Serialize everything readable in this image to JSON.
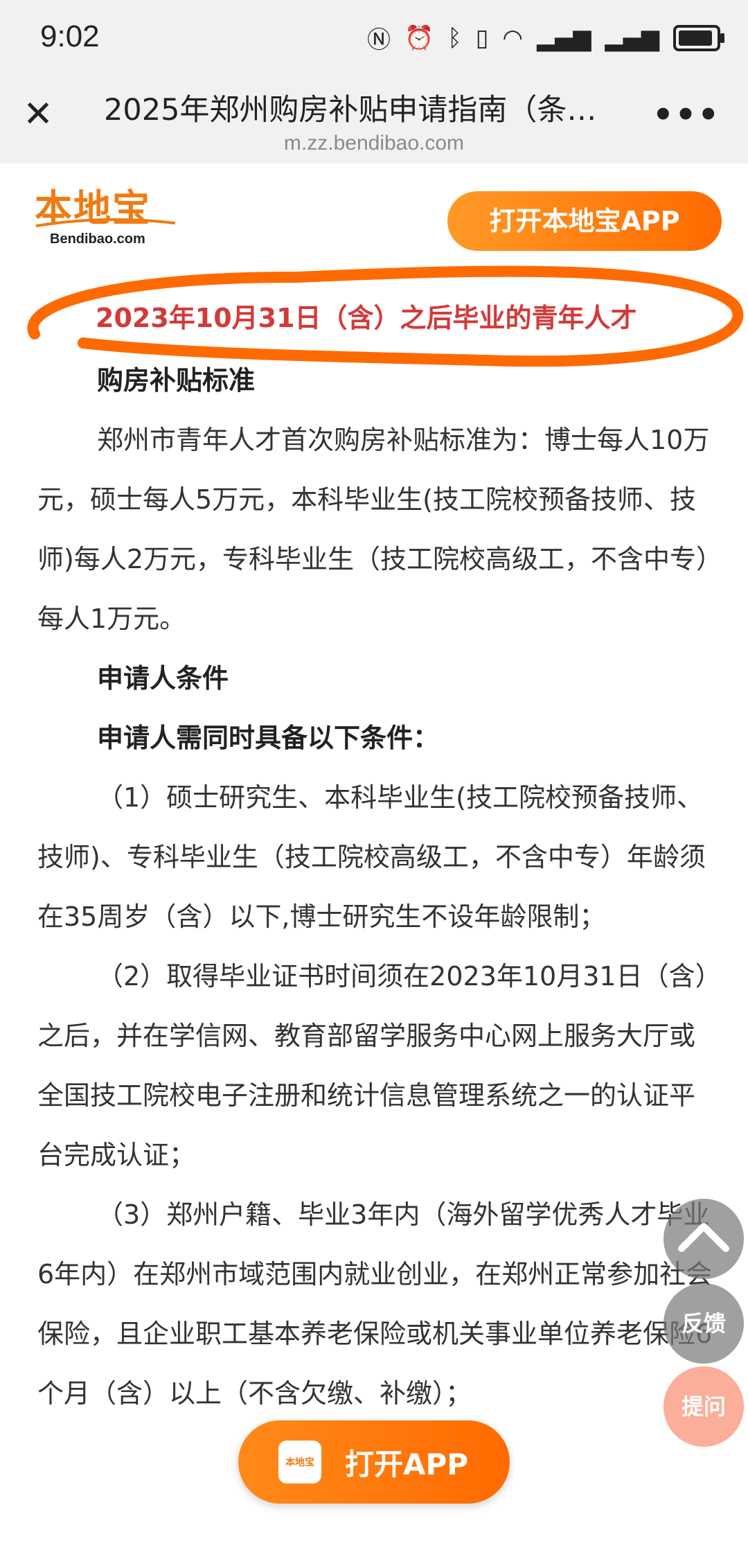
{
  "status_bar": {
    "time": "9:02",
    "icons": [
      "nfc-icon",
      "alarm-icon",
      "bluetooth-icon",
      "vibrate-icon",
      "wifi-icon",
      "signal-icon",
      "signal-icon",
      "battery-icon"
    ]
  },
  "browser": {
    "title": "2025年郑州购房补贴申请指南（条…",
    "url": "m.zz.bendibao.com",
    "more": "•••"
  },
  "site": {
    "logo_text": "本地宝",
    "logo_sub": "Bendibao.com",
    "open_app_top": "打开本地宝APP",
    "open_app_bottom": "打开APP",
    "app_icon_text": "本地宝"
  },
  "article": {
    "highlight_title": "2023年10月31日（含）之后毕业的青年人才",
    "h_subsidy": "购房补贴标准",
    "p_subsidy": "郑州市青年人才首次购房补贴标准为：博士每人10万元，硕士每人5万元，本科毕业生(技工院校预备技师、技师)每人2万元，专科毕业生（技工院校高级工，不含中专）每人1万元。",
    "h_conditions": "申请人条件",
    "h_conditions2": "申请人需同时具备以下条件：",
    "p1": "（1）硕士研究生、本科毕业生(技工院校预备技师、技师)、专科毕业生（技工院校高级工，不含中专）年龄须在35周岁（含）以下,博士研究生不设年龄限制；",
    "p2": "（2）取得毕业证书时间须在2023年10月31日（含）之后，并在学信网、教育部留学服务中心网上服务大厅或全国技工院校电子注册和统计信息管理系统之一的认证平台完成认证；",
    "p3": "（3）郑州户籍、毕业3年内（海外留学优秀人才毕业6年内）在郑州市域范围内就业创业，在郑州正常参加社会保险，且企业职工基本养老保险或机关事业单位养老保险6个月（含）以上（不含欠缴、补缴）；"
  },
  "fabs": {
    "feedback": "反馈",
    "ask": "提问"
  },
  "colors": {
    "accent": "#ff7a10",
    "highlight": "#d23a3a",
    "annotation": "#ff6a00"
  }
}
